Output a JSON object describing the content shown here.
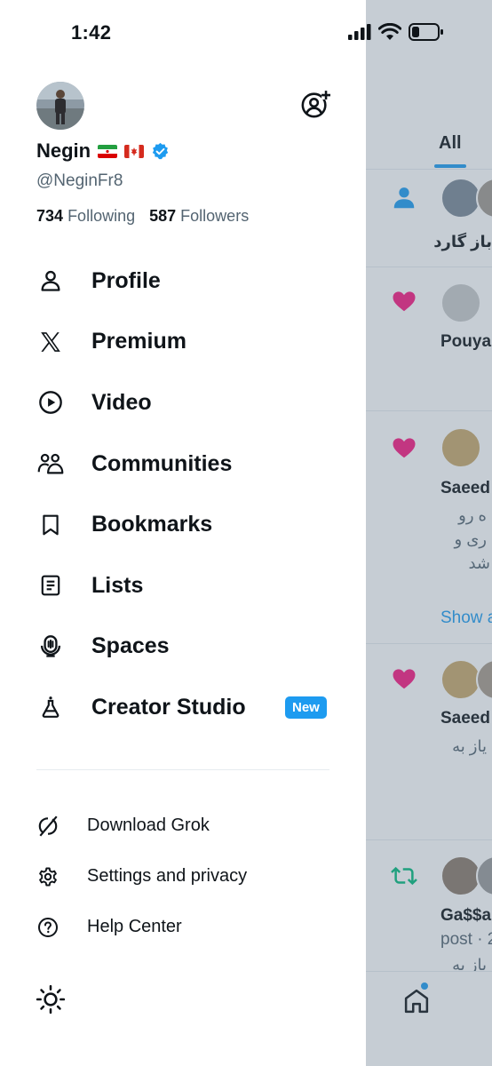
{
  "status_bar": {
    "time": "1:42"
  },
  "profile": {
    "display_name": "Negin",
    "flags": [
      "iran-flag",
      "canada-flag"
    ],
    "handle": "@NeginFr8",
    "following_count": "734",
    "following_label": "Following",
    "followers_count": "587",
    "followers_label": "Followers"
  },
  "menu": {
    "items": [
      {
        "label": "Profile",
        "icon": "person-icon"
      },
      {
        "label": "Premium",
        "icon": "x-logo-icon"
      },
      {
        "label": "Video",
        "icon": "play-circle-icon"
      },
      {
        "label": "Communities",
        "icon": "communities-icon"
      },
      {
        "label": "Bookmarks",
        "icon": "bookmark-icon"
      },
      {
        "label": "Lists",
        "icon": "list-icon"
      },
      {
        "label": "Spaces",
        "icon": "microphone-icon"
      },
      {
        "label": "Creator Studio",
        "icon": "flask-icon",
        "badge": "New"
      }
    ]
  },
  "sub_menu": {
    "items": [
      {
        "label": "Download Grok",
        "icon": "grok-icon"
      },
      {
        "label": "Settings and privacy",
        "icon": "gear-icon"
      },
      {
        "label": "Help Center",
        "icon": "help-icon"
      }
    ]
  },
  "feed": {
    "tab_all": "All",
    "items": [
      {
        "type": "follow",
        "text": "باز گارد"
      },
      {
        "type": "like",
        "name": "Pouya"
      },
      {
        "type": "like",
        "name": "Saeed",
        "lines": [
          "ه رو",
          "ری و",
          "شد"
        ],
        "show_more": "Show a"
      },
      {
        "type": "like",
        "name": "Saeed",
        "lines": [
          "یاز به"
        ]
      },
      {
        "type": "repost",
        "name": "Ga$$a",
        "sub": "post · 2",
        "lines": [
          "باز به"
        ]
      }
    ]
  },
  "colors": {
    "accent": "#1d9bf0",
    "like": "#f91880",
    "repost": "#00ba7c",
    "text": "#0f1419",
    "muted": "#536471"
  }
}
